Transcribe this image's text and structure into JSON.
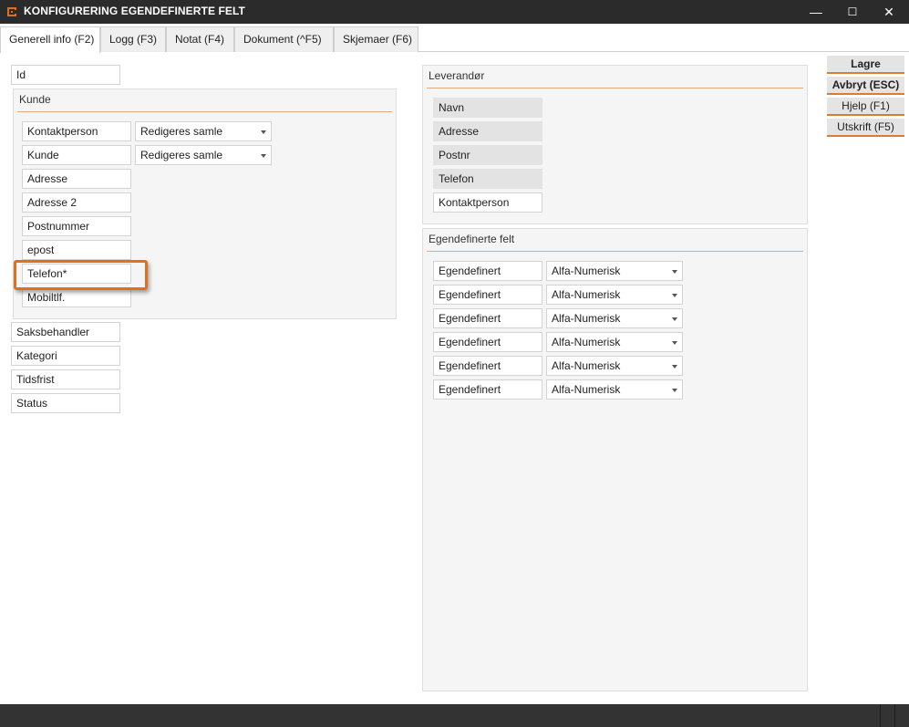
{
  "window": {
    "title": "KONFIGURERING EGENDEFINERTE FELT",
    "controls": {
      "minimize": "—",
      "maximize": "☐",
      "close": "✕"
    }
  },
  "tabs": [
    {
      "label": "Generell info (F2)",
      "active": true
    },
    {
      "label": "Logg (F3)"
    },
    {
      "label": "Notat (F4)"
    },
    {
      "label": "Dokument (^F5)"
    },
    {
      "label": "Skjemaer (F6)"
    }
  ],
  "left": {
    "id_field": "Id",
    "kunde_group": {
      "title": "Kunde",
      "fields": [
        "Kontaktperson",
        "Kunde",
        "Adresse",
        "Adresse 2",
        "Postnummer",
        "epost",
        "Telefon*",
        "Mobiltlf."
      ],
      "selects": [
        "Redigeres samle",
        "Redigeres samle"
      ]
    },
    "bottom_fields": [
      "Saksbehandler",
      "Kategori",
      "Tidsfrist",
      "Status"
    ]
  },
  "leverandor": {
    "title": "Leverandør",
    "fields": [
      "Navn",
      "Adresse",
      "Postnr",
      "Telefon",
      "Kontaktperson"
    ]
  },
  "egendefinerte": {
    "title": "Egendefinerte felt",
    "rows": [
      {
        "name": "Egendefinert",
        "type": "Alfa-Numerisk"
      },
      {
        "name": "Egendefinert",
        "type": "Alfa-Numerisk"
      },
      {
        "name": "Egendefinert",
        "type": "Alfa-Numerisk"
      },
      {
        "name": "Egendefinert",
        "type": "Alfa-Numerisk"
      },
      {
        "name": "Egendefinert",
        "type": "Alfa-Numerisk"
      },
      {
        "name": "Egendefinert",
        "type": "Alfa-Numerisk"
      }
    ]
  },
  "actions": {
    "save": "Lagre",
    "cancel": "Avbryt (ESC)",
    "help": "Hjelp (F1)",
    "print": "Utskrift (F5)"
  },
  "colors": {
    "accent": "#e0701e",
    "titlebar": "#2b2b2b",
    "statusbar": "#333333"
  }
}
